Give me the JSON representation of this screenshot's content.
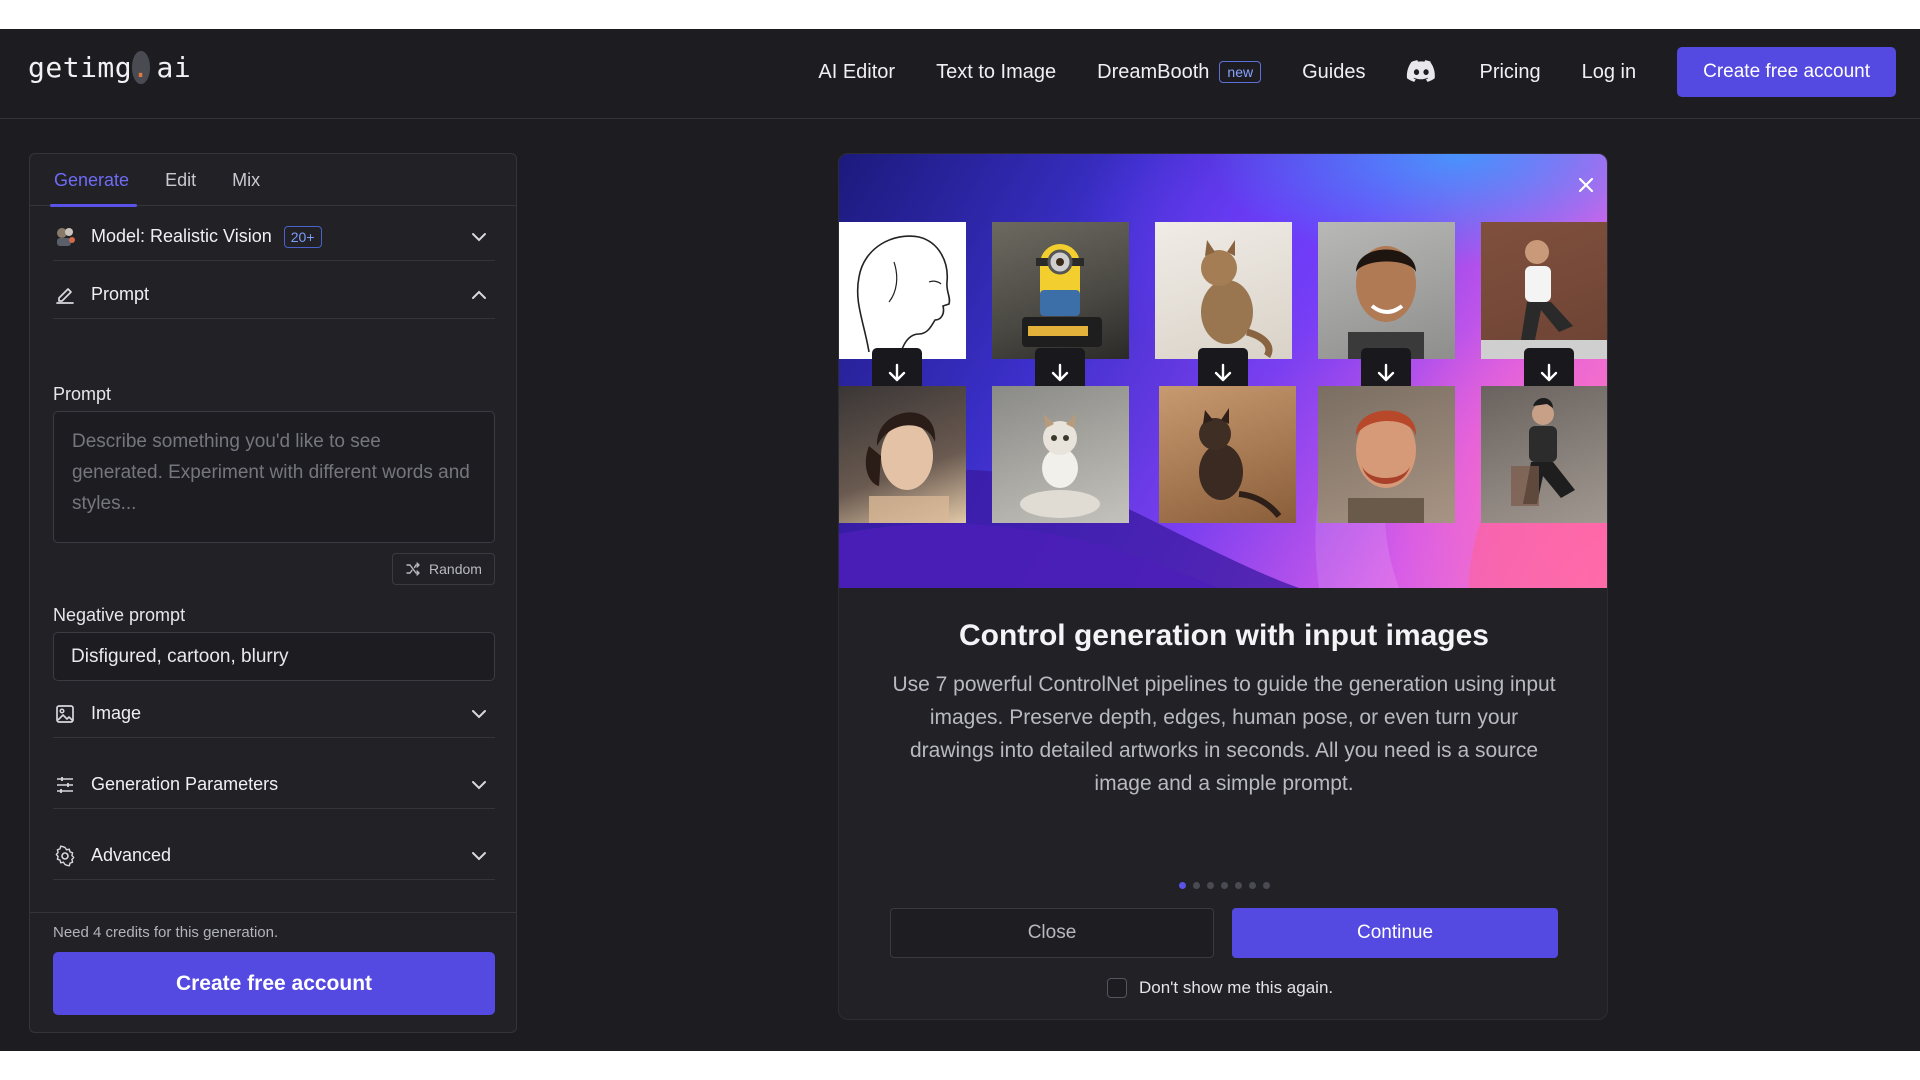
{
  "header": {
    "logo_main": "getimg",
    "logo_dot": ".",
    "logo_tail": "ai",
    "nav": [
      {
        "label": "AI Editor"
      },
      {
        "label": "Text to Image"
      },
      {
        "label": "DreamBooth",
        "badge": "new"
      },
      {
        "label": "Guides"
      },
      {
        "label": "Pricing"
      },
      {
        "label": "Log in"
      }
    ],
    "cta": "Create free account",
    "icons": {
      "discord": "discord-icon"
    }
  },
  "panel": {
    "tabs": [
      "Generate",
      "Edit",
      "Mix"
    ],
    "active_tab": "Generate",
    "model": {
      "label": "Model: Realistic Vision",
      "badge": "20+"
    },
    "prompt_section": "Prompt",
    "prompt_label": "Prompt",
    "prompt_placeholder": "Describe something you'd like to see generated. Experiment with different words and styles...",
    "random_label": "Random",
    "negative_label": "Negative prompt",
    "negative_value": "Disfigured, cartoon, blurry",
    "sections": [
      "Image",
      "Generation Parameters",
      "Advanced"
    ],
    "credits_note": "Need 4 credits for this generation.",
    "cta": "Create free account"
  },
  "modal": {
    "title": "Control generation with input images",
    "body": "Use 7 powerful ControlNet pipelines to guide the generation using input images. Preserve depth, edges, human pose, or even turn your drawings into detailed artworks in seconds. All you need is a source image and a simple prompt.",
    "slides_total": 7,
    "slide_active": 1,
    "close_label": "Close",
    "continue_label": "Continue",
    "dont_show_label": "Don't show me this again.",
    "dont_show_checked": false
  },
  "colors": {
    "accent": "#5449e0",
    "background": "#1d1d21",
    "panel": "#212126",
    "link_accent": "#6f6cf6"
  }
}
